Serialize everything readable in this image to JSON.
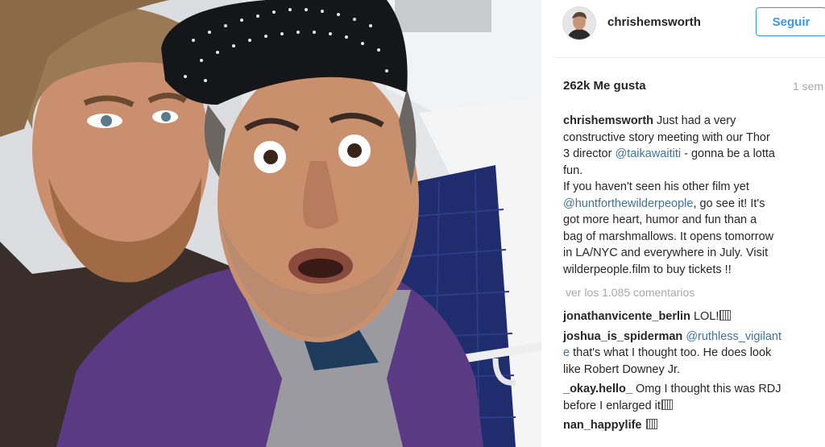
{
  "post": {
    "header": {
      "username": "chrishemsworth",
      "follow_label": "Seguir"
    },
    "likes": "262k Me gusta",
    "time": "1 sem",
    "caption": {
      "username": "chrishemsworth",
      "line1_text": " Just had a very",
      "line2": "constructive story meeting with our Thor",
      "line3_before": "3 director ",
      "line3_mention": "@taikawaititi",
      "line3_after": " - gonna be a lotta",
      "line4": "fun.",
      "line5": "If you haven't seen his other film yet",
      "line6_mention": "@huntforthewilderpeople",
      "line6_after": ", go see it! It's",
      "line7": "got more heart, humor and fun than a",
      "line8": "bag of marshmallows. It opens tomorrow",
      "line9": "in LA/NYC and everywhere in July. Visit",
      "line10": "wilderpeople.film to buy tickets !!"
    },
    "view_all_comments": "ver los 1.085 comentarios",
    "comments": [
      {
        "username": "jonathanvicente_berlin",
        "text": " LOL!"
      },
      {
        "username": "joshua_is_spiderman",
        "mention_part1": "@ruthless_vigilant",
        "mention_part2": "e",
        "text_line1_rest": "",
        "text_line2": " that's what I thought too. He does look",
        "text_line3": "like Robert Downey Jr."
      },
      {
        "username": "_okay.hello_",
        "text_line1": " Omg I thought this was RDJ",
        "text_line2": "before I enlarged it"
      },
      {
        "username": "nan_happylife",
        "text": " "
      }
    ],
    "colors": {
      "link": "#3f729b",
      "follow_blue": "#3897f0",
      "muted": "#a8a8a8",
      "text": "#262626"
    }
  }
}
